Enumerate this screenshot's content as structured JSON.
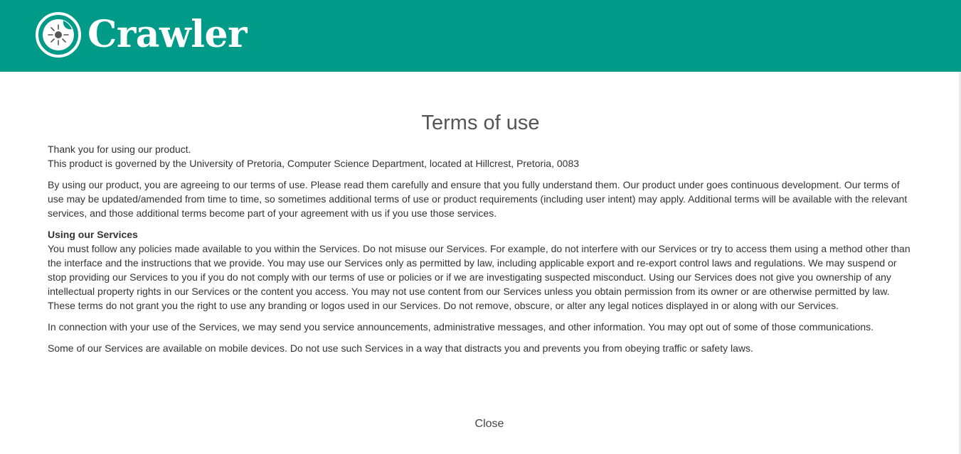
{
  "header": {
    "brand": "Crawler",
    "colors": {
      "background": "#009a88",
      "text": "#ffffff"
    },
    "logo_icon": "crawler-sun-icon"
  },
  "page": {
    "title": "Terms of use",
    "intro_line_1": "Thank you for using our product.",
    "intro_line_2": "This product is governed by the University of Pretoria, Computer Science Department, located at Hillcrest, Pretoria, 0083",
    "agreement": "By using our product, you are agreeing to our terms of use. Please read them carefully and ensure that you fully understand them. Our product under goes continuous development. Our terms of use may be updated/amended from time to time, so sometimes additional terms of use or product requirements (including user intent) may apply. Additional terms will be available with the relevant services, and those additional terms become part of your agreement with us if you use those services.",
    "services_heading": "Using our Services",
    "services_body": "You must follow any policies made available to you within the Services. Do not misuse our Services. For example, do not interfere with our Services or try to access them using a method other than the interface and the instructions that we provide. You may use our Services only as permitted by law, including applicable export and re-export control laws and regulations. We may suspend or stop providing our Services to you if you do not comply with our terms of use or policies or if we are investigating suspected misconduct. Using our Services does not give you ownership of any intellectual property rights in our Services or the content you access. You may not use content from our Services unless you obtain permission from its owner or are otherwise permitted by law. These terms do not grant you the right to use any branding or logos used in our Services. Do not remove, obscure, or alter any legal notices displayed in or along with our Services.",
    "communications": "In connection with your use of the Services, we may send you service announcements, administrative messages, and other information. You may opt out of some of those communications.",
    "mobile": "Some of our Services are available on mobile devices. Do not use such Services in a way that distracts you and prevents you from obeying traffic or safety laws.",
    "close_label": "Close"
  }
}
